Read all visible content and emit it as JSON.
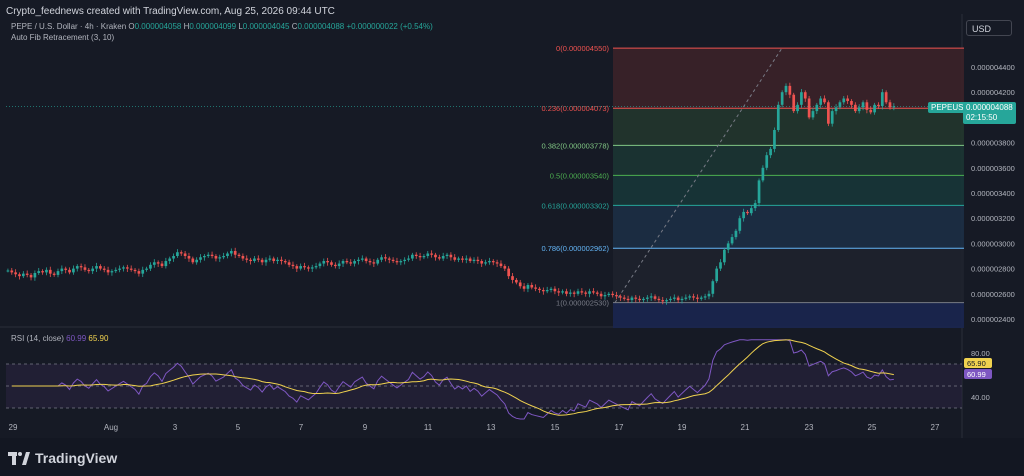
{
  "header": "Crypto_feednews created with TradingView.com, Aug 25, 2026 09:44 UTC",
  "currency_button": "USD",
  "legend": {
    "symbol": "PEPE / U.S. Dollar · 4h · Kraken",
    "o_label": "O",
    "o": "0.000004058",
    "h_label": "H",
    "h": "0.000004099",
    "l_label": "L",
    "l": "0.000004045",
    "c_label": "C",
    "c": "0.000004088",
    "change": "+0.000000022 (+0.54%)",
    "indicator": "Auto Fib Retracement (3, 10)"
  },
  "rsi_legend": {
    "label": "RSI (14, close)",
    "v1": "60.99",
    "v2": "65.90"
  },
  "price_badge": {
    "symbol": "PEPEUSD",
    "price": "0.000004088",
    "countdown": "02:15:50"
  },
  "logo_text": "TradingView",
  "colors": {
    "bull": "#26a69a",
    "bear": "#ef5350",
    "rsi": "#7e57c2",
    "rsi_ma": "#f0d24f",
    "bg": "#161a25"
  },
  "chart_data": {
    "type": "candlestick",
    "price_axis": {
      "min": 2.4e-06,
      "max": 4.6e-06,
      "ticks": [
        "0.000004400",
        "0.000004200",
        "0.000004000",
        "0.000003800",
        "0.000003600",
        "0.000003400",
        "0.000003200",
        "0.000003000",
        "0.000002800",
        "0.000002600",
        "0.000002400"
      ]
    },
    "time_labels": [
      "29",
      "Aug",
      "3",
      "5",
      "7",
      "9",
      "11",
      "13",
      "15",
      "17",
      "19",
      "21",
      "23",
      "25",
      "27"
    ],
    "fib_levels": [
      {
        "label": "0(0.000004550)",
        "value": 4.55e-06,
        "color": "#ef5350",
        "fill": "#3b2229"
      },
      {
        "label": "0.236(0.000004073)",
        "value": 4.073e-06,
        "color": "#ef5350",
        "fill": "#22362e"
      },
      {
        "label": "0.382(0.000003778)",
        "value": 3.778e-06,
        "color": "#81c784",
        "fill": "#1b3533"
      },
      {
        "label": "0.5(0.000003540)",
        "value": 3.54e-06,
        "color": "#4caf50",
        "fill": "#173638"
      },
      {
        "label": "0.618(0.000003302)",
        "value": 3.302e-06,
        "color": "#26a69a",
        "fill": "#1c2f45"
      },
      {
        "label": "0.786(0.000002962)",
        "value": 2.962e-06,
        "color": "#64b5f6",
        "fill": "#1e222d"
      },
      {
        "label": "1(0.000002530)",
        "value": 2.53e-06,
        "color": "#787b86",
        "fill": "#1a2650"
      }
    ],
    "rsi": {
      "upper": 70,
      "lower": 30,
      "ticks": [
        "80.00",
        "40.00"
      ],
      "current": 60.99,
      "ma": 65.9
    },
    "series_close": [
      2.785,
      2.77,
      2.755,
      2.74,
      2.76,
      2.75,
      2.73,
      2.765,
      2.78,
      2.77,
      2.79,
      2.76,
      2.75,
      2.78,
      2.8,
      2.79,
      2.77,
      2.8,
      2.82,
      2.81,
      2.79,
      2.78,
      2.8,
      2.82,
      2.8,
      2.79,
      2.77,
      2.78,
      2.79,
      2.8,
      2.81,
      2.8,
      2.79,
      2.78,
      2.76,
      2.79,
      2.8,
      2.83,
      2.85,
      2.84,
      2.82,
      2.86,
      2.88,
      2.9,
      2.93,
      2.92,
      2.9,
      2.88,
      2.85,
      2.87,
      2.89,
      2.9,
      2.91,
      2.9,
      2.88,
      2.89,
      2.9,
      2.92,
      2.94,
      2.91,
      2.9,
      2.88,
      2.87,
      2.86,
      2.88,
      2.87,
      2.85,
      2.87,
      2.88,
      2.86,
      2.87,
      2.86,
      2.85,
      2.83,
      2.82,
      2.8,
      2.82,
      2.81,
      2.8,
      2.81,
      2.82,
      2.84,
      2.86,
      2.85,
      2.83,
      2.82,
      2.84,
      2.86,
      2.85,
      2.84,
      2.86,
      2.87,
      2.88,
      2.86,
      2.85,
      2.84,
      2.87,
      2.89,
      2.88,
      2.87,
      2.86,
      2.85,
      2.86,
      2.87,
      2.88,
      2.91,
      2.9,
      2.89,
      2.9,
      2.92,
      2.91,
      2.89,
      2.88,
      2.9,
      2.91,
      2.89,
      2.87,
      2.88,
      2.87,
      2.88,
      2.86,
      2.87,
      2.86,
      2.84,
      2.85,
      2.86,
      2.85,
      2.84,
      2.82,
      2.8,
      2.74,
      2.71,
      2.69,
      2.66,
      2.64,
      2.67,
      2.65,
      2.64,
      2.63,
      2.62,
      2.63,
      2.64,
      2.62,
      2.61,
      2.62,
      2.6,
      2.61,
      2.6,
      2.62,
      2.61,
      2.6,
      2.62,
      2.61,
      2.6,
      2.58,
      2.59,
      2.6,
      2.59,
      2.58,
      2.57,
      2.56,
      2.55,
      2.57,
      2.56,
      2.55,
      2.56,
      2.57,
      2.58,
      2.56,
      2.55,
      2.54,
      2.55,
      2.56,
      2.57,
      2.55,
      2.56,
      2.57,
      2.58,
      2.57,
      2.56,
      2.57,
      2.58,
      2.6,
      2.7,
      2.8,
      2.85,
      2.95,
      3.0,
      3.05,
      3.1,
      3.2,
      3.25,
      3.24,
      3.28,
      3.32,
      3.5,
      3.6,
      3.7,
      3.75,
      3.9,
      4.1,
      4.2,
      4.25,
      4.18,
      4.05,
      4.1,
      4.2,
      4.15,
      4.0,
      4.05,
      4.1,
      4.15,
      4.12,
      3.95,
      4.05,
      4.08,
      4.12,
      4.15,
      4.13,
      4.1,
      4.05,
      4.08,
      4.12,
      4.06,
      4.04,
      4.1,
      4.09,
      4.2,
      4.12,
      4.08,
      4.088
    ]
  }
}
